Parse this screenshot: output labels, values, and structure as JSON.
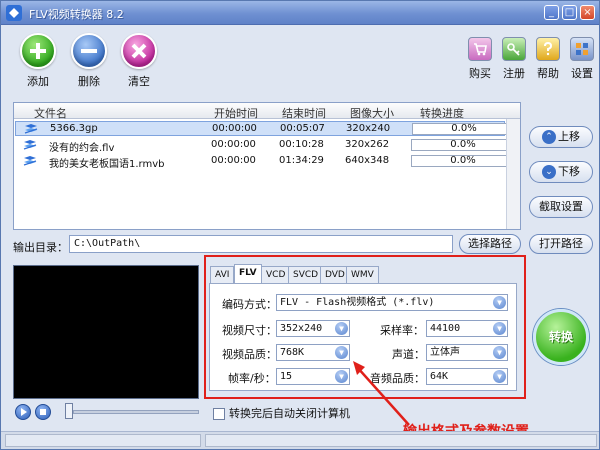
{
  "window": {
    "title": "FLV视频转换器 8.2"
  },
  "toolbar": {
    "add_label": "添加",
    "delete_label": "删除",
    "clear_label": "清空",
    "buy_label": "购买",
    "register_label": "注册",
    "help_label": "帮助",
    "settings_label": "设置"
  },
  "filelist": {
    "columns": [
      "文件名",
      "开始时间",
      "结束时间",
      "图像大小",
      "转换进度"
    ],
    "rows": [
      {
        "name": "5366.3gp",
        "start": "00:00:00",
        "end": "00:05:07",
        "size": "320x240",
        "progress": "0.0%"
      },
      {
        "name": "没有的约会.flv",
        "start": "00:00:00",
        "end": "00:10:28",
        "size": "320x262",
        "progress": "0.0%"
      },
      {
        "name": "我的美女老板国语1.rmvb",
        "start": "00:00:00",
        "end": "01:34:29",
        "size": "640x348",
        "progress": "0.0%"
      }
    ]
  },
  "side": {
    "up_label": "上移",
    "down_label": "下移",
    "capture_label": "截取设置",
    "open_path_label": "打开路径"
  },
  "output": {
    "label": "输出目录：",
    "path": "C:\\OutPath\\",
    "browse_label": "选择路径"
  },
  "format": {
    "tabs": [
      "AVI",
      "FLV",
      "VCD",
      "SVCD",
      "DVD",
      "WMV"
    ],
    "active_tab": "FLV",
    "codec_label": "编码方式：",
    "codec_value": "FLV - Flash视频格式 (*.flv)",
    "video_size_label": "视频尺寸：",
    "video_size_value": "352x240",
    "sample_rate_label": "采样率：",
    "sample_rate_value": "44100",
    "video_quality_label": "视频品质：",
    "video_quality_value": "768K",
    "channel_label": "声道：",
    "channel_value": "立体声",
    "framerate_label": "帧率/秒：",
    "framerate_value": "15",
    "audio_quality_label": "音频品质：",
    "audio_quality_value": "64K"
  },
  "convert_label": "转换",
  "shutdown_label": "转换完后自动关闭计算机",
  "annotation_text": "输出格式及参数设置",
  "colors": {
    "accent_red": "#e0201a",
    "title_blue": "#6f90d2"
  }
}
